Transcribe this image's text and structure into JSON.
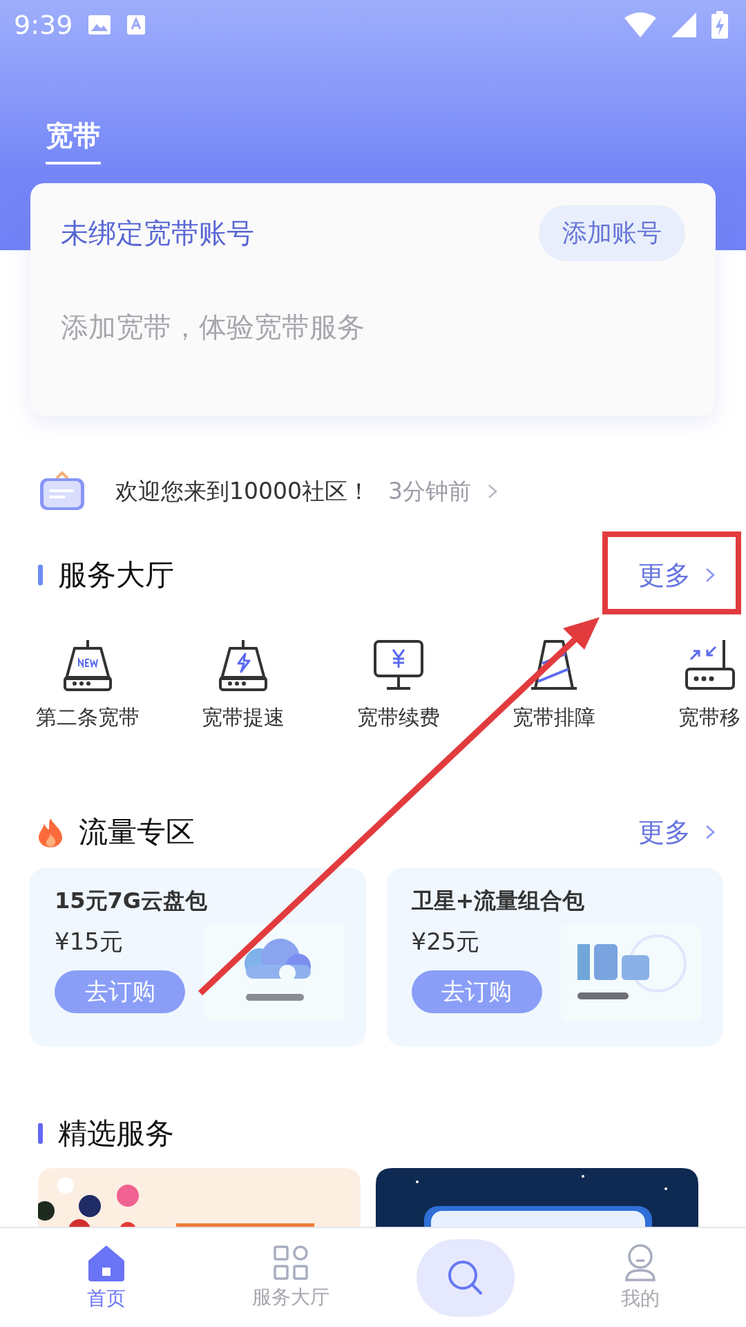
{
  "status_bar": {
    "time": "9:39"
  },
  "header": {
    "tabs": [
      {
        "label": "宽带",
        "selected": true
      }
    ]
  },
  "account_card": {
    "title": "未绑定宽带账号",
    "button": "添加账号",
    "subtitle": "添加宽带，体验宽带服务"
  },
  "notice": {
    "text": "欢迎您来到10000社区！",
    "time": "3分钟前"
  },
  "service_hall": {
    "title": "服务大厅",
    "more": "更多",
    "items": [
      {
        "label": "第二条宽带",
        "kind": "new-router"
      },
      {
        "label": "宽带提速",
        "kind": "boost-router"
      },
      {
        "label": "宽带续费",
        "kind": "monitor"
      },
      {
        "label": "宽带排障",
        "kind": "cone"
      },
      {
        "label": "宽带移",
        "kind": "transfer-router"
      }
    ]
  },
  "data_zone": {
    "title": "流量专区",
    "more": "更多",
    "products": [
      {
        "name": "15元7G云盘包",
        "price": "¥15元",
        "button": "去订购",
        "kind": "picture"
      },
      {
        "name": "卫星+流量组合包",
        "price": "¥25元",
        "button": "去订购",
        "kind": "picture"
      }
    ]
  },
  "featured": {
    "title": "精选服务"
  },
  "bottom_nav": {
    "items": [
      {
        "label": "首页",
        "kind": "home",
        "selected": true
      },
      {
        "label": "服务大厅",
        "kind": "grid",
        "selected": false
      },
      {
        "kind": "search",
        "selected": false
      },
      {
        "label": "我的",
        "kind": "user",
        "selected": false
      }
    ]
  },
  "annotation": {
    "highlight_box": true,
    "arrow": true
  }
}
